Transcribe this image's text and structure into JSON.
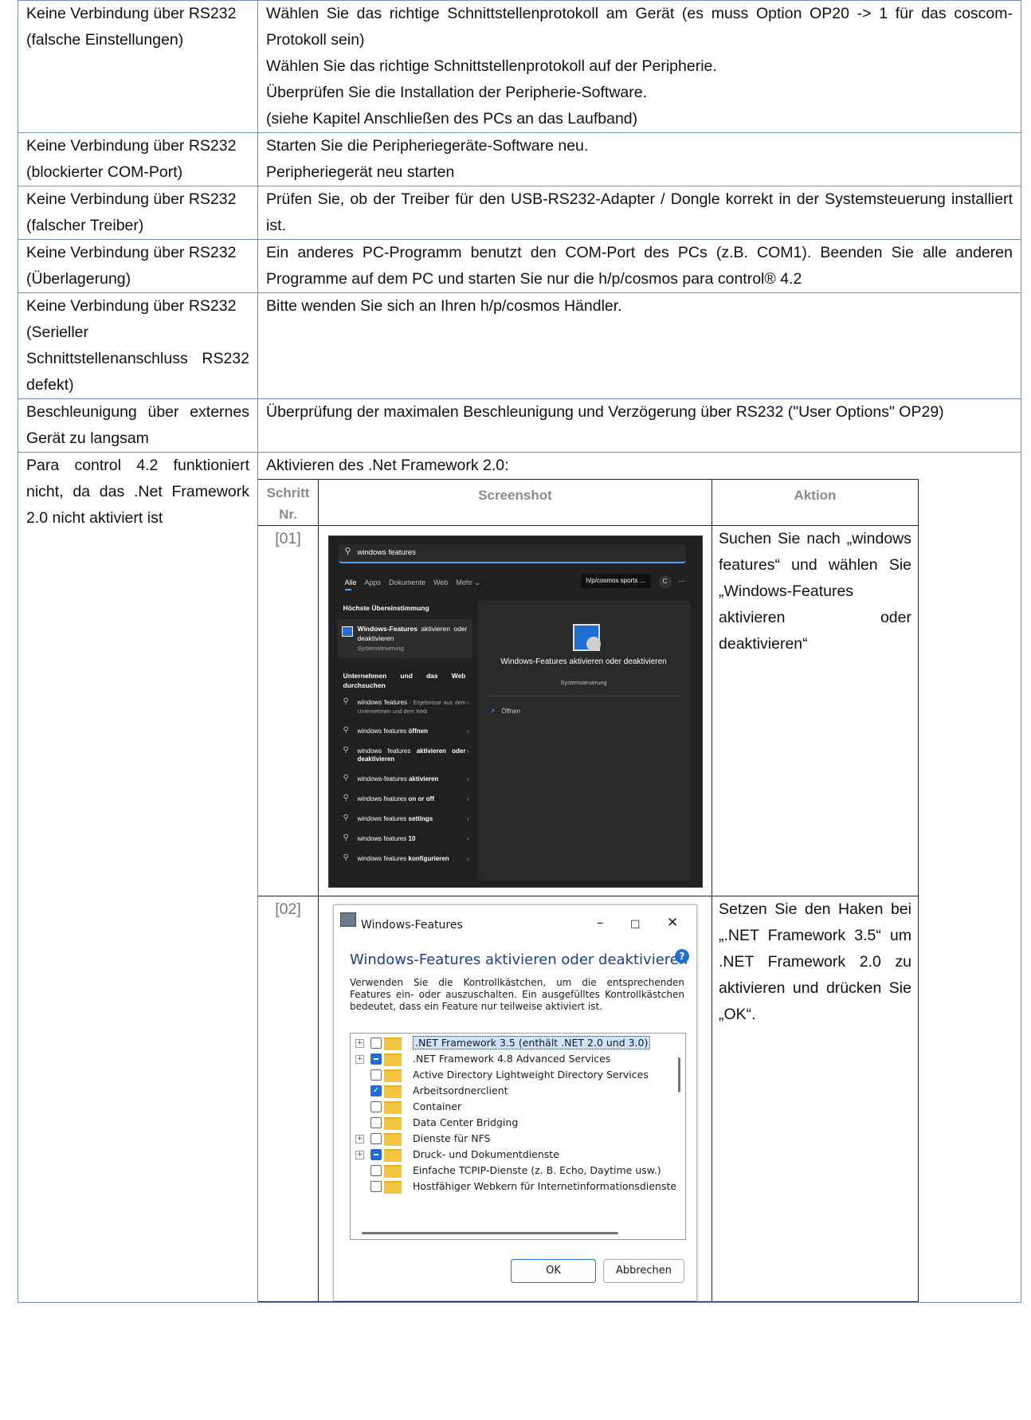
{
  "rows": [
    {
      "problem": [
        "Keine Verbindung über RS232",
        "(falsche Einstellungen)"
      ],
      "solution": [
        "Wählen Sie das richtige Schnittstellenprotokoll am Gerät (es muss Option OP20 -> 1 für das coscom-Protokoll sein)",
        "Wählen Sie das richtige Schnittstellenprotokoll auf der Peripherie.",
        "Überprüfen Sie die Installation der Peripherie-Software.",
        "(siehe Kapitel Anschließen des PCs an das Laufband)"
      ]
    },
    {
      "problem": [
        "Keine Verbindung über RS232",
        "(blockierter COM-Port)"
      ],
      "solution": [
        "Starten Sie die Peripheriegeräte-Software neu.",
        "Peripheriegerät neu starten"
      ]
    },
    {
      "problem": [
        "Keine Verbindung über RS232",
        "(falscher Treiber)"
      ],
      "solution": [
        "Prüfen Sie, ob der Treiber für den USB-RS232-Adapter / Dongle korrekt in der Systemsteuerung installiert ist."
      ]
    },
    {
      "problem": [
        "Keine Verbindung über RS232",
        "(Überlagerung)"
      ],
      "solution": [
        "Ein anderes PC-Programm benutzt den COM-Port des PCs (z.B. COM1). Beenden Sie alle anderen Programme auf dem PC und starten Sie nur die h/p/cosmos para control® 4.2"
      ]
    },
    {
      "problem": [
        "Keine Verbindung über RS232",
        "(Serieller Schnittstellenanschluss RS232 defekt)"
      ],
      "solution": [
        "Bitte wenden Sie sich an Ihren h/p/cosmos Händler."
      ]
    },
    {
      "problem": [
        "Beschleunigung über externes Gerät zu langsam"
      ],
      "solution": [
        "Überprüfung der maximalen Beschleunigung und Verzögerung über RS232 (\"User Options\" OP29)"
      ]
    }
  ],
  "last_row": {
    "problem": "Para control 4.2 funktioniert nicht, da das .Net Framework 2.0 nicht aktiviert ist",
    "intro": "Aktivieren des .Net Framework 2.0:",
    "headers": {
      "step": "Schritt Nr.",
      "screenshot": "Screenshot",
      "action": "Aktion"
    },
    "steps": [
      {
        "no": "[01]",
        "action": "Suchen Sie nach „windows features“ und wählen Sie „Windows-Features aktivieren oder deaktivieren“"
      },
      {
        "no": "[02]",
        "action": "Setzen Sie den Haken bei „.NET Framework 3.5“ um .NET Framework 2.0 zu aktivieren und drücken Sie „OK“."
      }
    ]
  },
  "search_shot": {
    "query": "windows features",
    "tabs": [
      "Alle",
      "Apps",
      "Dokumente",
      "Web",
      "Mehr ⌄"
    ],
    "account": "h/p/cosmos sports ...",
    "account_initial": "C",
    "more": "···",
    "best_match_title": "Höchste Übereinstimmung",
    "best_match_name_bold": "Windows-Features",
    "best_match_name_rest": " aktivieren oder deaktivieren",
    "best_match_sub": "Systemsteuerung",
    "web_section_title": "Unternehmen und das Web durchsuchen",
    "results": [
      {
        "plain": "windows features",
        "bold": "",
        "extra": " - Ergebnisse aus dem Unternehmen und dem Web"
      },
      {
        "plain": "windows features ",
        "bold": "öffnen",
        "extra": ""
      },
      {
        "plain": "windows features ",
        "bold": "aktivieren oder deaktivieren",
        "extra": ""
      },
      {
        "plain": "windows-features ",
        "bold": "aktivieren",
        "extra": ""
      },
      {
        "plain": "windows features ",
        "bold": "on or off",
        "extra": ""
      },
      {
        "plain": "windows features ",
        "bold": "settings",
        "extra": ""
      },
      {
        "plain": "windows features ",
        "bold": "10",
        "extra": ""
      },
      {
        "plain": "windows features ",
        "bold": "konfigurieren",
        "extra": ""
      }
    ],
    "preview_title": "Windows-Features aktivieren oder deaktivieren",
    "preview_sub": "Systemsteuerung",
    "open_label": "Öffnen"
  },
  "dialog_shot": {
    "window_title": "Windows-Features",
    "heading": "Windows-Features aktivieren oder deaktivieren",
    "description": "Verwenden Sie die Kontrollkästchen, um die entsprechenden Features ein- oder auszuschalten. Ein ausgefülltes Kontrollkästchen bedeutet, dass ein Feature nur teilweise aktiviert ist.",
    "features": [
      {
        "label": ".NET Framework 3.5 (enthält .NET 2.0 und 3.0)",
        "state": "unchecked",
        "expandable": true,
        "selected": true
      },
      {
        "label": ".NET Framework 4.8 Advanced Services",
        "state": "partial",
        "expandable": true,
        "selected": false
      },
      {
        "label": "Active Directory Lightweight Directory Services",
        "state": "unchecked",
        "expandable": false,
        "selected": false
      },
      {
        "label": "Arbeitsordnerclient",
        "state": "checked",
        "expandable": false,
        "selected": false
      },
      {
        "label": "Container",
        "state": "unchecked",
        "expandable": false,
        "selected": false
      },
      {
        "label": "Data Center Bridging",
        "state": "unchecked",
        "expandable": false,
        "selected": false
      },
      {
        "label": "Dienste für NFS",
        "state": "unchecked",
        "expandable": true,
        "selected": false
      },
      {
        "label": "Druck- und Dokumentdienste",
        "state": "partial",
        "expandable": true,
        "selected": false
      },
      {
        "label": "Einfache TCPIP-Dienste (z. B. Echo, Daytime usw.)",
        "state": "unchecked",
        "expandable": false,
        "selected": false
      },
      {
        "label": "Hostfähiger Webkern für Internetinformationsdienste",
        "state": "unchecked",
        "expandable": false,
        "selected": false
      }
    ],
    "ok_label": "OK",
    "cancel_label": "Abbrechen"
  }
}
